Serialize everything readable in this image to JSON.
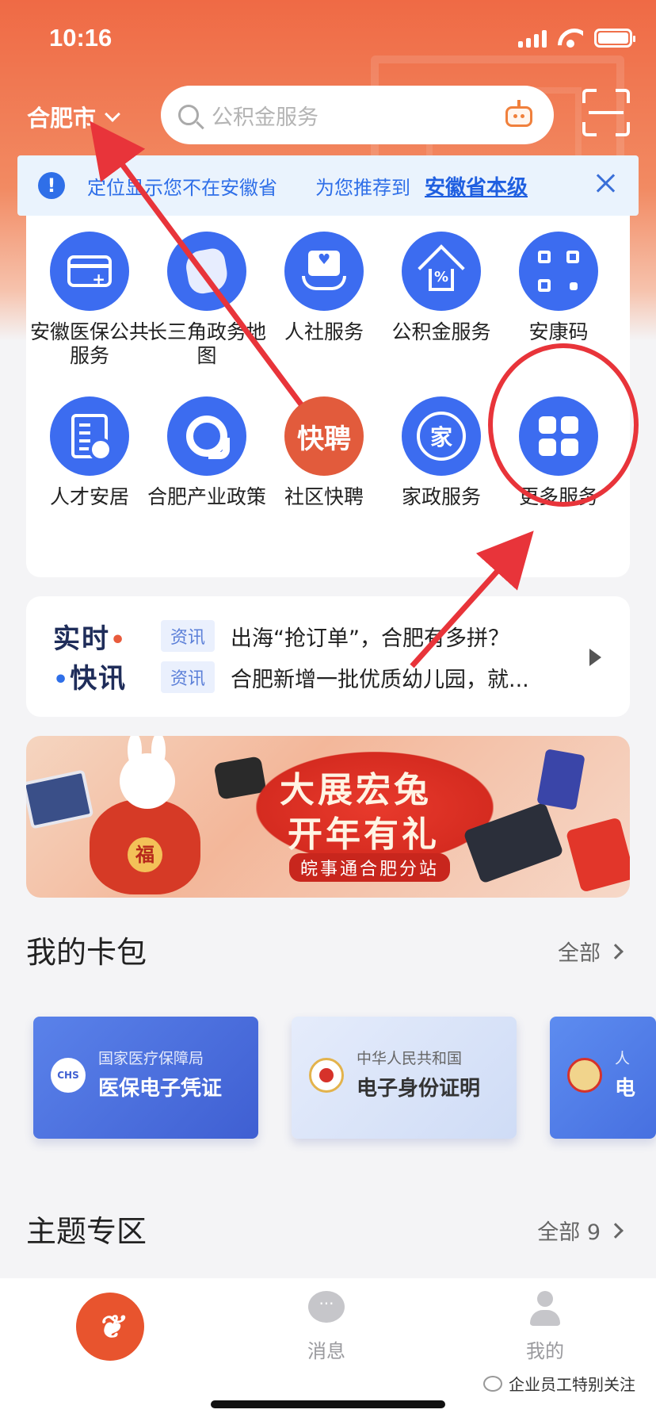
{
  "status_bar": {
    "time": "10:16"
  },
  "header": {
    "city": "合肥市",
    "search_placeholder": "公积金服务"
  },
  "notice": {
    "text": "定位显示您不在安徽省",
    "recommend": "为您推荐到",
    "link": "安徽省本级"
  },
  "services": [
    {
      "label": "安徽医保公共服务",
      "icon": "medical-card-icon"
    },
    {
      "label": "长三角政务地图",
      "icon": "map-icon"
    },
    {
      "label": "人社服务",
      "icon": "social-security-icon"
    },
    {
      "label": "公积金服务",
      "icon": "housing-fund-icon"
    },
    {
      "label": "安康码",
      "icon": "qr-code-icon"
    },
    {
      "label": "人才安居",
      "icon": "document-user-icon"
    },
    {
      "label": "合肥产业政策",
      "icon": "policy-icon"
    },
    {
      "label": "社区快聘",
      "icon": "kuaipin-icon",
      "icon_text": "快聘"
    },
    {
      "label": "家政服务",
      "icon": "housekeeping-icon"
    },
    {
      "label": "更多服务",
      "icon": "more-grid-icon"
    }
  ],
  "news": {
    "brand_line1": "实时",
    "brand_line2": "快讯",
    "items": [
      {
        "tag": "资讯",
        "title": "出海“抢订单”，合肥有多拼？"
      },
      {
        "tag": "资讯",
        "title": "合肥新增一批优质幼儿园，就..."
      }
    ]
  },
  "banner": {
    "title1": "大展宏兔",
    "title2": "开年有礼",
    "subtitle": "皖事通合肥分站",
    "fu": "福"
  },
  "wallet": {
    "title": "我的卡包",
    "all_label": "全部",
    "cards": [
      {
        "issuer": "国家医疗保障局",
        "name": "医保电子凭证",
        "logo": "CHS"
      },
      {
        "issuer": "中华人民共和国",
        "name": "电子身份证明"
      },
      {
        "issuer": "人",
        "name": "电"
      }
    ]
  },
  "topics": {
    "title": "主题专区",
    "all_label": "全部 9"
  },
  "tabbar": {
    "home_glyph": "❦",
    "messages": "消息",
    "me": "我的"
  },
  "watermark": "企业员工特别关注",
  "colors": {
    "brand_orange": "#ef6a45",
    "service_blue": "#3c6cf0",
    "annotation_red": "#e8343a"
  }
}
